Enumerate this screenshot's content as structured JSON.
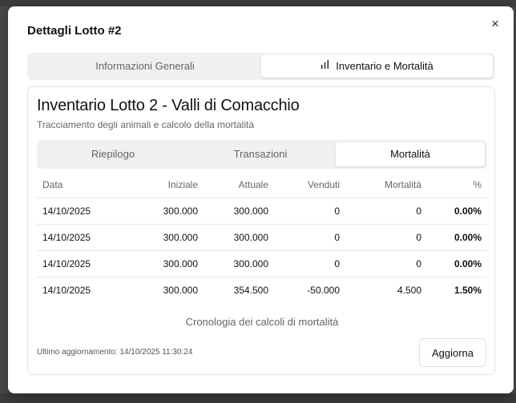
{
  "dialog": {
    "title": "Dettagli Lotto #2",
    "close_glyph": "×",
    "close_icon": "close-icon"
  },
  "main_tabs": [
    {
      "label": "Informazioni Generali",
      "active": false
    },
    {
      "label": "Inventario e Mortalità",
      "active": true,
      "icon": "bar-chart-icon"
    }
  ],
  "card": {
    "title": "Inventario Lotto 2 - Valli di Comacchio",
    "subtitle": "Tracciamento degli animali e calcolo della mortalità",
    "tabs": [
      {
        "label": "Riepilogo",
        "active": false
      },
      {
        "label": "Transazioni",
        "active": false
      },
      {
        "label": "Mortalità",
        "active": true
      }
    ],
    "table": {
      "columns": [
        "Data",
        "Iniziale",
        "Attuale",
        "Venduti",
        "Mortalità",
        "%"
      ],
      "rows": [
        [
          "14/10/2025",
          "300.000",
          "300.000",
          "0",
          "0",
          "0.00%"
        ],
        [
          "14/10/2025",
          "300.000",
          "300.000",
          "0",
          "0",
          "0.00%"
        ],
        [
          "14/10/2025",
          "300.000",
          "300.000",
          "0",
          "0",
          "0.00%"
        ],
        [
          "14/10/2025",
          "300.000",
          "354.500",
          "-50.000",
          "4.500",
          "1.50%"
        ]
      ]
    },
    "caption": "Cronologia dei calcoli di mortalità",
    "updated": "Ultimo aggiornamento: 14/10/2025 11:30:24",
    "refresh_label": "Aggiorna"
  }
}
